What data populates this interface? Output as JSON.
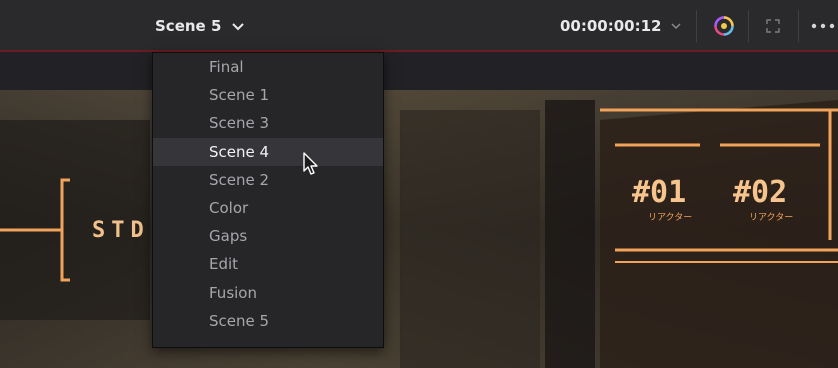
{
  "header": {
    "scene_title": "Scene 5",
    "timecode": "00:00:00:12"
  },
  "dropdown": {
    "items": [
      "Final",
      "Scene 1",
      "Scene 3",
      "Scene 4",
      "Scene 2",
      "Color",
      "Gaps",
      "Edit",
      "Fusion",
      "Scene 5"
    ],
    "hovered": "Scene 4"
  },
  "viewer": {
    "sign_left": "STD",
    "tag1": "#01",
    "tag1_sub": "リアクター",
    "tag2": "#02",
    "tag2_sub": "リアクター"
  },
  "colors": {
    "accent_line": "#6a1d22",
    "neon": "#f2a35a"
  },
  "icons": [
    "chevron-down-icon",
    "color-wheel-icon",
    "fullscreen-icon",
    "more-options-icon",
    "mouse-pointer-icon"
  ]
}
